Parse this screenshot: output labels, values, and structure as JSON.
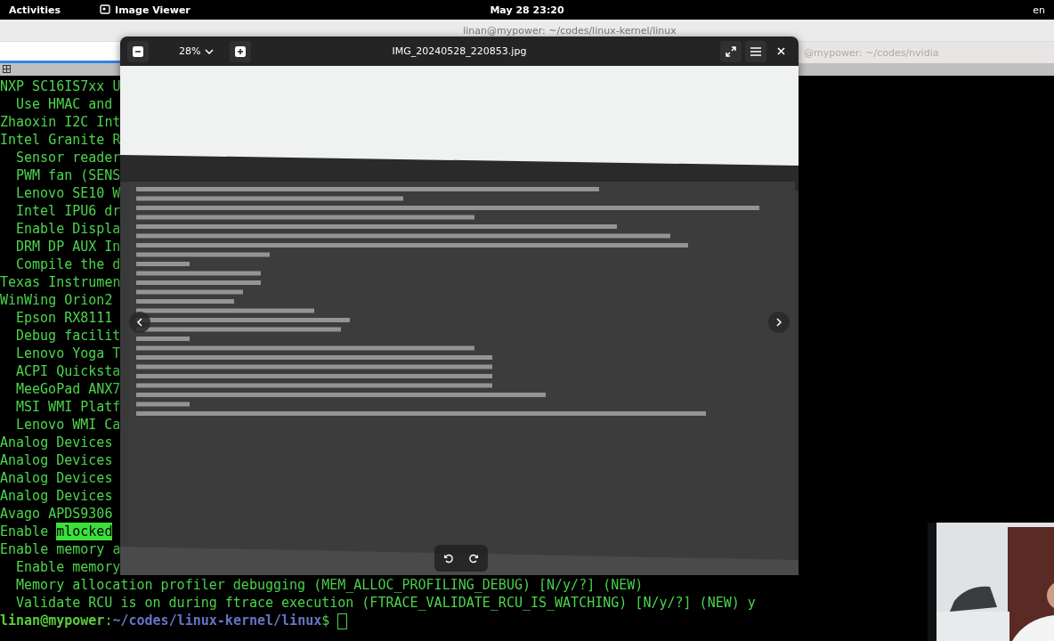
{
  "top_bar": {
    "activities": "Activities",
    "app_name": "Image Viewer",
    "clock": "May 28  23:20",
    "language": "en"
  },
  "terminal": {
    "title": "linan@mypower: ~/codes/linux-kernel/linux",
    "tabs": [
      {
        "selected": true
      },
      {
        "label": "@mypower: ~/codes/nvidia",
        "selected": false
      }
    ],
    "lines": [
      {
        "indented": false,
        "segments": [
          {
            "text": "NXP SC16IS7xx U",
            "highlighted": false
          }
        ]
      },
      {
        "indented": true,
        "segments": [
          {
            "text": "Use HMAC and",
            "highlighted": false
          }
        ]
      },
      {
        "indented": false,
        "segments": [
          {
            "text": "Zhaoxin I2C Int",
            "highlighted": false
          }
        ]
      },
      {
        "indented": false,
        "segments": [
          {
            "text": "Intel Granite R",
            "highlighted": false
          }
        ]
      },
      {
        "indented": true,
        "segments": [
          {
            "text": "Sensor reader",
            "highlighted": false
          }
        ]
      },
      {
        "indented": true,
        "segments": [
          {
            "text": "PWM fan (SENS",
            "highlighted": false
          }
        ]
      },
      {
        "indented": true,
        "segments": [
          {
            "text": "Lenovo SE10 W",
            "highlighted": false
          }
        ]
      },
      {
        "indented": true,
        "segments": [
          {
            "text": "Intel IPU6 dr",
            "highlighted": false
          }
        ]
      },
      {
        "indented": true,
        "segments": [
          {
            "text": "Enable Displa",
            "highlighted": false
          }
        ]
      },
      {
        "indented": true,
        "segments": [
          {
            "text": "DRM DP AUX In",
            "highlighted": false
          }
        ]
      },
      {
        "indented": true,
        "segments": [
          {
            "text": "Compile the d",
            "highlighted": false
          }
        ]
      },
      {
        "indented": false,
        "segments": [
          {
            "text": "Texas Instrumen",
            "highlighted": false
          }
        ]
      },
      {
        "indented": false,
        "segments": [
          {
            "text": "WinWing Orion2",
            "highlighted": false
          }
        ]
      },
      {
        "indented": true,
        "segments": [
          {
            "text": "Epson RX8111",
            "highlighted": false
          }
        ]
      },
      {
        "indented": true,
        "segments": [
          {
            "text": "Debug facilit",
            "highlighted": false
          }
        ]
      },
      {
        "indented": true,
        "segments": [
          {
            "text": "Lenovo Yoga T",
            "highlighted": false
          }
        ]
      },
      {
        "indented": true,
        "segments": [
          {
            "text": "ACPI Quicksta",
            "highlighted": false
          }
        ]
      },
      {
        "indented": true,
        "segments": [
          {
            "text": "MeeGoPad ANX7",
            "highlighted": false
          }
        ]
      },
      {
        "indented": true,
        "segments": [
          {
            "text": "MSI WMI Platf",
            "highlighted": false
          }
        ]
      },
      {
        "indented": true,
        "segments": [
          {
            "text": "Lenovo WMI Ca",
            "highlighted": false
          }
        ]
      },
      {
        "indented": false,
        "segments": [
          {
            "text": "Analog Devices",
            "highlighted": false
          }
        ]
      },
      {
        "indented": false,
        "segments": [
          {
            "text": "Analog Devices",
            "highlighted": false
          }
        ]
      },
      {
        "indented": false,
        "segments": [
          {
            "text": "Analog Devices",
            "highlighted": false
          }
        ]
      },
      {
        "indented": false,
        "segments": [
          {
            "text": "Analog Devices",
            "highlighted": false
          }
        ]
      },
      {
        "indented": false,
        "segments": [
          {
            "text": "Avago APDS9306",
            "highlighted": false
          }
        ]
      },
      {
        "indented": false,
        "segments": [
          {
            "text": "Enable ",
            "highlighted": false
          },
          {
            "text": "mlocked",
            "highlighted": true
          }
        ]
      },
      {
        "indented": false,
        "segments": [
          {
            "text": "Enable memory a",
            "highlighted": false
          }
        ]
      },
      {
        "indented": true,
        "segments": [
          {
            "text": "Enable memory",
            "highlighted": false
          }
        ]
      },
      {
        "indented": true,
        "segments": [
          {
            "text": "Memory allocation profiler debugging (MEM_ALLOC_PROFILING_DEBUG) [N/y/?] (NEW)",
            "highlighted": false
          }
        ]
      },
      {
        "indented": true,
        "segments": [
          {
            "text": "Validate RCU is on during ftrace execution (FTRACE_VALIDATE_RCU_IS_WATCHING) [N/y/?] (NEW) y",
            "highlighted": false
          }
        ]
      }
    ],
    "prompt": {
      "user_host": "linan@mypower",
      "separator": ":",
      "path": "~/codes/linux-kernel/linux",
      "symbol": "$"
    }
  },
  "image_viewer": {
    "zoom": "28%",
    "file_name": "IMG_20240528_220853.jpg"
  }
}
